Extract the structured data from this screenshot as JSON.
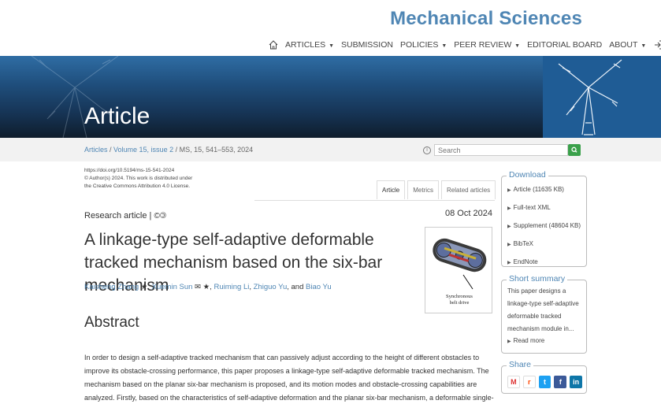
{
  "header": {
    "journal_title": "Mechanical Sciences",
    "nav": [
      {
        "label": "ARTICLES",
        "caret": true
      },
      {
        "label": "SUBMISSION",
        "caret": false
      },
      {
        "label": "POLICIES",
        "caret": true
      },
      {
        "label": "PEER REVIEW",
        "caret": true
      },
      {
        "label": "EDITORIAL BOARD",
        "caret": false
      },
      {
        "label": "ABOUT",
        "caret": true
      }
    ]
  },
  "banner": {
    "title": "Article"
  },
  "breadcrumb": {
    "articles": "Articles",
    "sep1": " / ",
    "volume": "Volume 15, issue 2",
    "sep2": " / ",
    "current": "MS, 15, 541–553, 2024"
  },
  "search": {
    "placeholder": "Search",
    "info": "i"
  },
  "meta": {
    "doi": "https://doi.org/10.5194/ms-15-541-2024",
    "copyright": "© Author(s) 2024. This work is distributed under",
    "license": "the Creative Commons Attribution 4.0 License."
  },
  "tabs": [
    "Article",
    "Metrics",
    "Related articles"
  ],
  "article": {
    "type": "Research article | ",
    "cc": "©🄯",
    "date": "08 Oct 2024",
    "title": "A linkage-type self-adaptive deformable tracked mechanism based on the six-bar mechanism",
    "authors": [
      {
        "name": "Kaisheng Zhang",
        "suffix": " ★, "
      },
      {
        "name": "Xuemin Sun",
        "suffix": " ✉ ★, "
      },
      {
        "name": "Ruiming Li",
        "suffix": ", "
      },
      {
        "name": "Zhiguo Yu",
        "suffix": ", and "
      },
      {
        "name": "Biao Yu",
        "suffix": ""
      }
    ],
    "ga_caption_1": "Synchronous",
    "ga_caption_2": "belt drive",
    "abstract_heading": "Abstract",
    "abstract_text": "In order to design a self-adaptive tracked mechanism that can passively adjust according to the height of different obstacles to improve its obstacle-crossing performance, this paper proposes a linkage-type self-adaptive deformable tracked mechanism. The mechanism based on the planar six-bar mechanism is proposed, and its motion modes and obstacle-crossing capabilities are analyzed. Firstly, based on the characteristics of self-adaptive deformation and the planar six-bar mechanism, a deformable single-"
  },
  "sidebar": {
    "download_title": "Download",
    "download_items": [
      "Article (11635 KB)",
      "Full-text XML",
      "Supplement (48604 KB)",
      "BibTeX",
      "EndNote"
    ],
    "summary_title": "Short summary",
    "summary_text": "This paper designs a linkage-type self-adaptive deformable tracked mechanism module in...",
    "read_more": "Read more",
    "share_title": "Share",
    "share_icons": [
      "mendeley-icon",
      "reddit-icon",
      "twitter-icon",
      "facebook-icon",
      "linkedin-icon"
    ]
  },
  "colors": {
    "accent": "#4f86b4",
    "search_button": "#3aa04a"
  }
}
